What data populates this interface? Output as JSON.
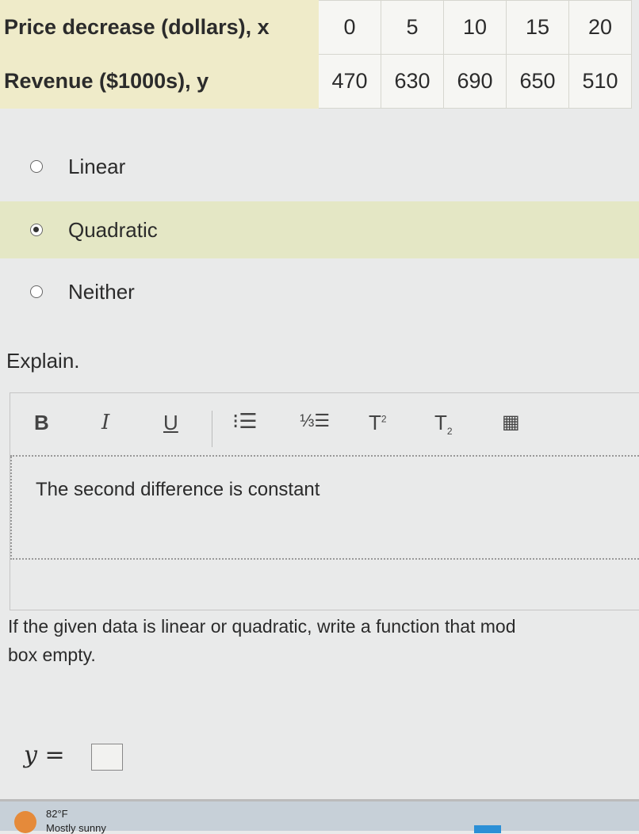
{
  "table": {
    "rows": [
      {
        "header": "Price decrease (dollars), x",
        "values": [
          "0",
          "5",
          "10",
          "15",
          "20"
        ]
      },
      {
        "header": "Revenue ($1000s), y",
        "values": [
          "470",
          "630",
          "690",
          "650",
          "510"
        ]
      }
    ]
  },
  "options": [
    {
      "label": "Linear",
      "selected": false
    },
    {
      "label": "Quadratic",
      "selected": true
    },
    {
      "label": "Neither",
      "selected": false
    }
  ],
  "explain_label": "Explain.",
  "editor": {
    "tools": [
      "B",
      "I",
      "U",
      "bulleted-list",
      "numbered-list",
      "superscript",
      "subscript",
      "table"
    ],
    "text": "The second difference is constant"
  },
  "question": {
    "line1": "If the given data is linear or quadratic, write a function that mod",
    "line2": "box empty."
  },
  "answer": {
    "label": "y",
    "equals": "=",
    "value": ""
  },
  "taskbar": {
    "temperature": "82°F",
    "condition": "Mostly sunny"
  }
}
